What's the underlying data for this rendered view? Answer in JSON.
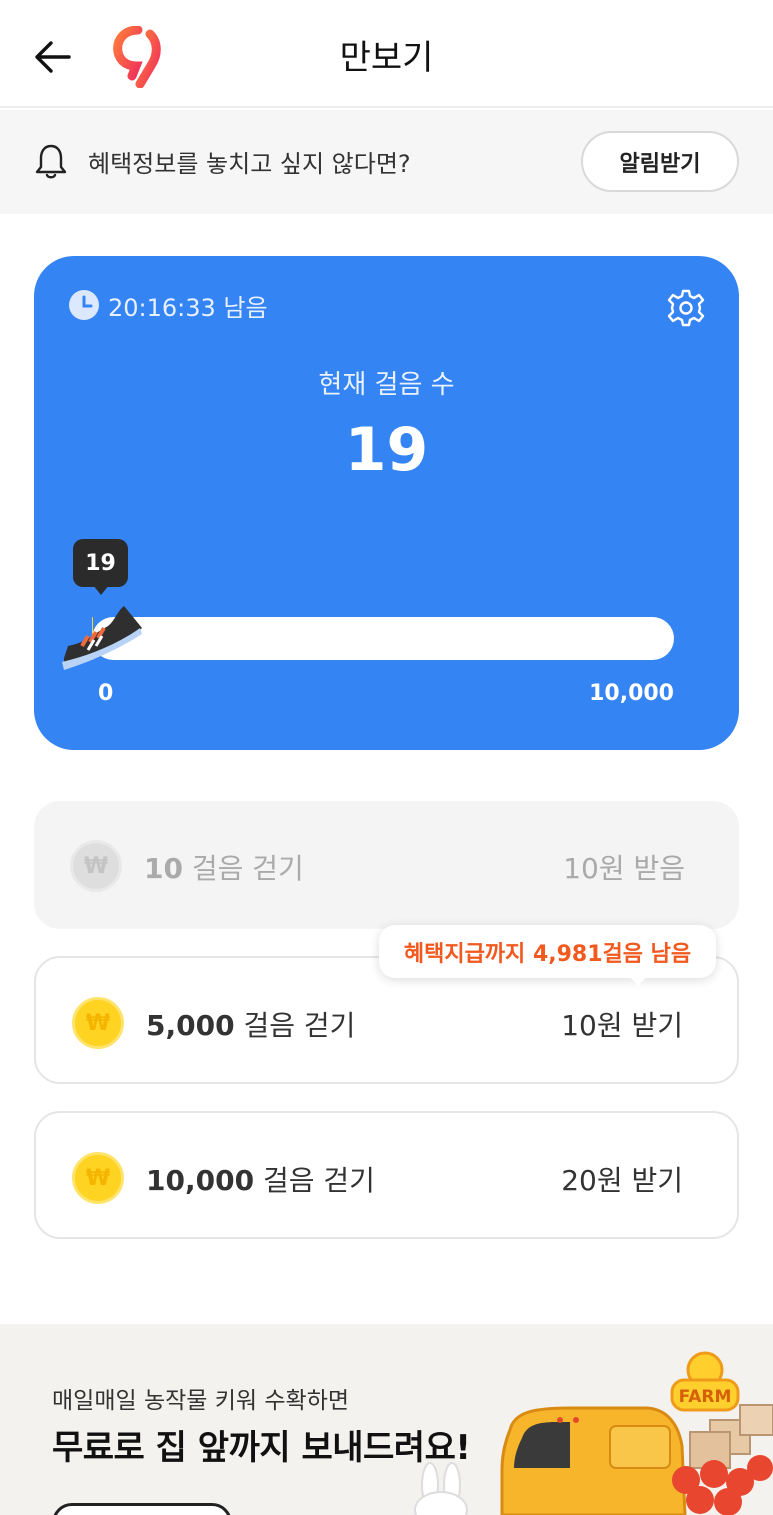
{
  "header": {
    "title": "만보기"
  },
  "notice": {
    "text": "혜택정보를 놓치고 싶지 않다면?",
    "button_label": "알림받기"
  },
  "card": {
    "time_left": "20:16:33 남음",
    "steps_label": "현재 걸음 수",
    "steps_value": "19",
    "bubble_value": "19",
    "progress_fraction": 0.0019,
    "axis_min": "0",
    "axis_max": "10,000",
    "accent": "#3584f4"
  },
  "rewards": [
    {
      "steps": "10",
      "suffix": "걸음 걷기",
      "reward": "10원 받음",
      "state": "done"
    },
    {
      "steps": "5,000",
      "suffix": "걸음 걷기",
      "reward": "10원 받기",
      "state": "todo"
    },
    {
      "steps": "10,000",
      "suffix": "걸음 걷기",
      "reward": "20원 받기",
      "state": "todo"
    }
  ],
  "tooltip": {
    "text": "혜택지급까지 4,981걸음 남음",
    "color": "#f2591f"
  },
  "banner": {
    "subtitle": "매일매일 농작물 키워 수확하면",
    "title": "무료로 집 앞까지 보내드려요!",
    "logo_text": "FARM"
  }
}
